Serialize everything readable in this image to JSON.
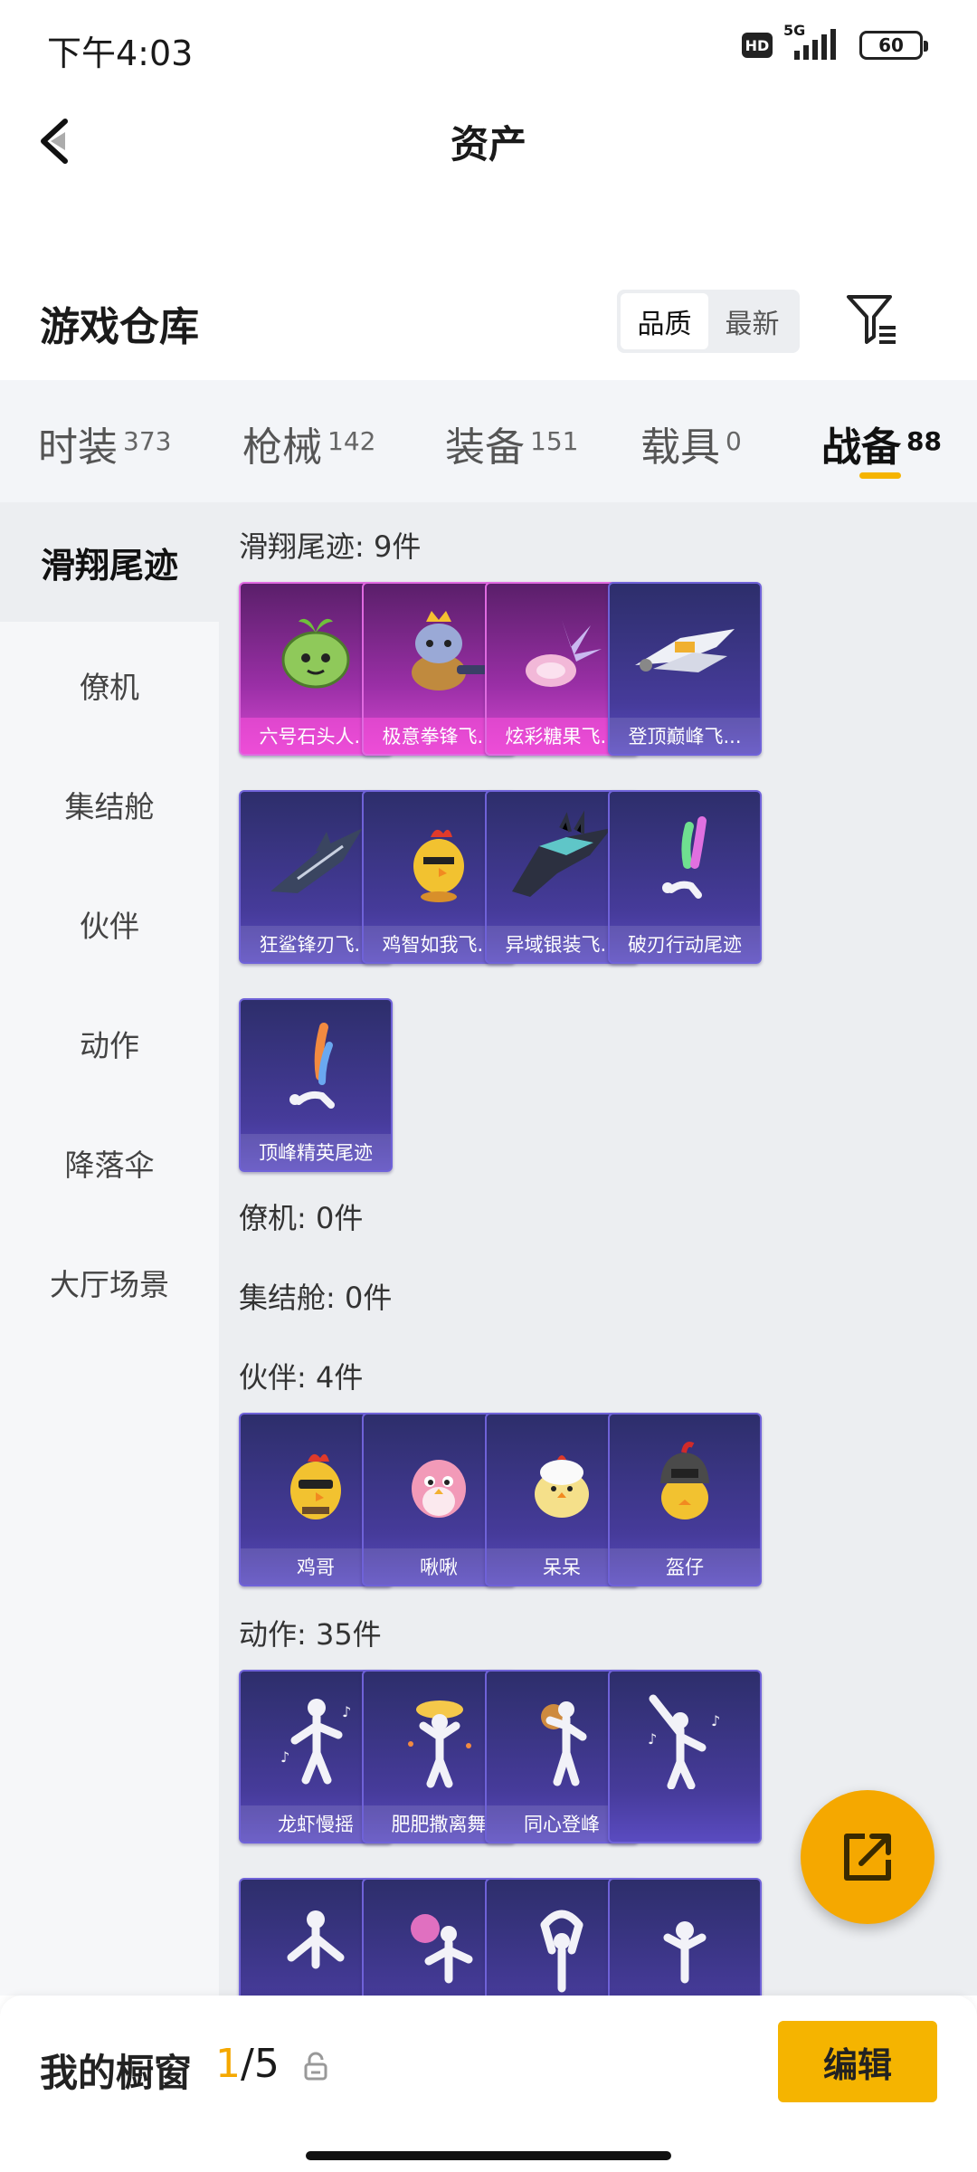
{
  "status_bar": {
    "time": "下午4:03",
    "hd": "HD",
    "network": "5G",
    "battery": "60"
  },
  "header": {
    "title": "资产"
  },
  "warehouse": {
    "title": "游戏仓库",
    "sort_options": [
      "品质",
      "最新"
    ],
    "active_sort": "品质"
  },
  "tabs": [
    {
      "label": "时装",
      "count": "373"
    },
    {
      "label": "枪械",
      "count": "142"
    },
    {
      "label": "装备",
      "count": "151"
    },
    {
      "label": "载具",
      "count": "0"
    },
    {
      "label": "战备",
      "count": "88",
      "active": true
    }
  ],
  "side_nav": [
    "滑翔尾迹",
    "僚机",
    "集结舱",
    "伙伴",
    "动作",
    "降落伞",
    "大厅场景"
  ],
  "sections": {
    "glide": {
      "title": "滑翔尾迹: 9件",
      "items": [
        "六号石头人...",
        "极意拳锋飞...",
        "炫彩糖果飞...",
        "登顶巅峰飞...",
        "狂鲨锋刃飞...",
        "鸡智如我飞...",
        "异域银装飞...",
        "破刃行动尾迹",
        "顶峰精英尾迹"
      ]
    },
    "wingman": {
      "title": "僚机: 0件"
    },
    "pod": {
      "title": "集结舱: 0件"
    },
    "partner": {
      "title": "伙伴: 4件",
      "items": [
        "鸡哥",
        "啾啾",
        "呆呆",
        "盔仔"
      ]
    },
    "emote": {
      "title": "动作: 35件",
      "items": [
        "龙虾慢摇",
        "肥肥撒离舞",
        "同心登峰"
      ]
    }
  },
  "bottom": {
    "showcase_label": "我的橱窗",
    "current": "1",
    "total": "/5",
    "edit": "编辑"
  },
  "colors": {
    "accent": "#f5b400",
    "card_purple": "#463b9a",
    "card_pink": "#d74ad2"
  }
}
